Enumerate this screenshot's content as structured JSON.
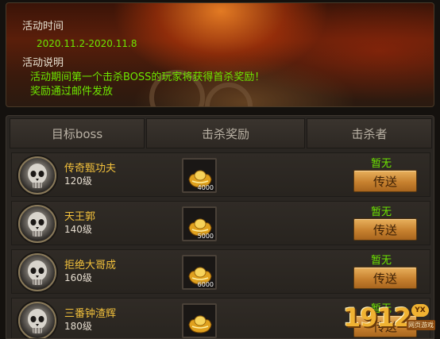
{
  "banner": {
    "time_title": "活动时间",
    "date_range": "2020.11.2-2020.11.8",
    "desc_title": "活动说明",
    "desc_line1": "活动期间第一个击杀BOSS的玩家将获得首杀奖励！",
    "desc_line2": "奖励通过邮件发放"
  },
  "table": {
    "headers": [
      "目标boss",
      "击杀奖励",
      "击杀者"
    ],
    "rows": [
      {
        "name": "传奇甄功夫",
        "level": "120级",
        "reward_icon": "gold-ingot-icon",
        "reward_count": "4000",
        "killer": "暂无",
        "button": "传送"
      },
      {
        "name": "天王郭",
        "level": "140级",
        "reward_icon": "gold-ingot-icon",
        "reward_count": "5000",
        "killer": "暂无",
        "button": "传送"
      },
      {
        "name": "拒绝大哥成",
        "level": "160级",
        "reward_icon": "gold-ingot-icon",
        "reward_count": "6000",
        "killer": "暂无",
        "button": "传送"
      },
      {
        "name": "三番钟渣辉",
        "level": "180级",
        "reward_icon": "gold-ingot-icon",
        "reward_count": "",
        "killer": "暂无",
        "button": "传送"
      }
    ]
  },
  "watermark": {
    "number": "1912",
    "badge": "YX",
    "subtitle": "网页游戏"
  },
  "colors": {
    "highlight_green": "#6ee600",
    "boss_name_gold": "#f4c23c",
    "button_orange": "#c7812f"
  }
}
